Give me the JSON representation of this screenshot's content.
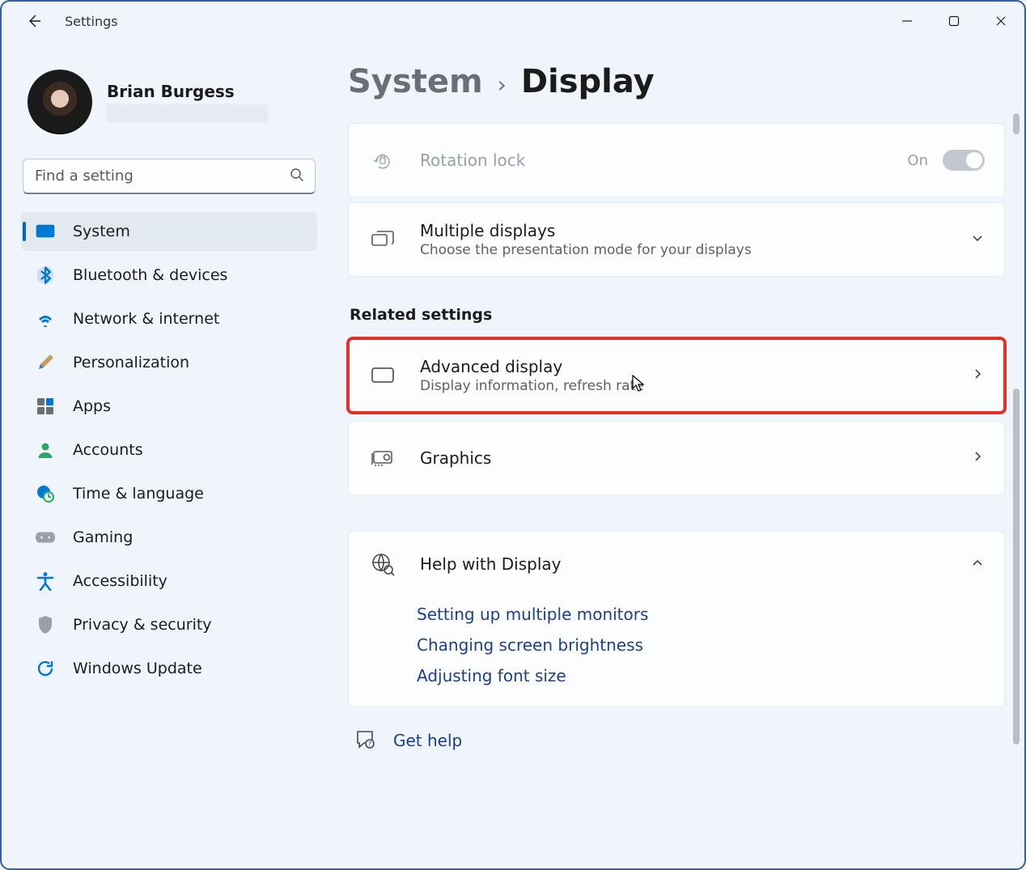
{
  "window": {
    "title": "Settings"
  },
  "user": {
    "name": "Brian Burgess"
  },
  "search": {
    "placeholder": "Find a setting"
  },
  "sidebar": {
    "items": [
      {
        "key": "system",
        "label": "System"
      },
      {
        "key": "bluetooth",
        "label": "Bluetooth & devices"
      },
      {
        "key": "network",
        "label": "Network & internet"
      },
      {
        "key": "personalization",
        "label": "Personalization"
      },
      {
        "key": "apps",
        "label": "Apps"
      },
      {
        "key": "accounts",
        "label": "Accounts"
      },
      {
        "key": "time",
        "label": "Time & language"
      },
      {
        "key": "gaming",
        "label": "Gaming"
      },
      {
        "key": "accessibility",
        "label": "Accessibility"
      },
      {
        "key": "privacy",
        "label": "Privacy & security"
      },
      {
        "key": "update",
        "label": "Windows Update"
      }
    ]
  },
  "breadcrumb": {
    "root": "System",
    "leaf": "Display"
  },
  "rows": {
    "rotation": {
      "title": "Rotation lock",
      "state": "On"
    },
    "multi": {
      "title": "Multiple displays",
      "sub": "Choose the presentation mode for your displays"
    },
    "related_heading": "Related settings",
    "advanced": {
      "title": "Advanced display",
      "sub": "Display information, refresh rate"
    },
    "graphics": {
      "title": "Graphics"
    },
    "help_header": "Help with Display",
    "help_links": [
      "Setting up multiple monitors",
      "Changing screen brightness",
      "Adjusting font size"
    ],
    "get_help": "Get help"
  },
  "colors": {
    "accent": "#0067c0",
    "link": "#1a3f8c",
    "highlight": "#e33126"
  }
}
